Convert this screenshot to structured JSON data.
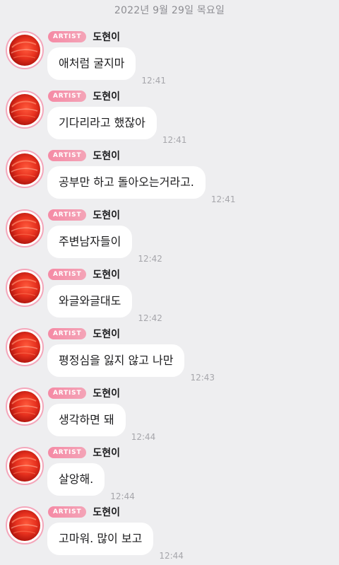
{
  "date_header": "2022년 9월 29일 목요일",
  "messages": [
    {
      "badge": "ARTIST",
      "sender": "도현이",
      "text": "애처럼 굴지마",
      "time": "12:41"
    },
    {
      "badge": "ARTIST",
      "sender": "도현이",
      "text": "기다리라고 했잖아",
      "time": "12:41"
    },
    {
      "badge": "ARTIST",
      "sender": "도현이",
      "text": "공부만 하고 돌아오는거라고.",
      "time": "12:41"
    },
    {
      "badge": "ARTIST",
      "sender": "도현이",
      "text": "주변남자들이",
      "time": "12:42"
    },
    {
      "badge": "ARTIST",
      "sender": "도현이",
      "text": "와글와글대도",
      "time": "12:42"
    },
    {
      "badge": "ARTIST",
      "sender": "도현이",
      "text": "평정심을 잃지 않고 나만",
      "time": "12:43"
    },
    {
      "badge": "ARTIST",
      "sender": "도현이",
      "text": "생각하면 돼",
      "time": "12:44"
    },
    {
      "badge": "ARTIST",
      "sender": "도현이",
      "text": "살앙해.",
      "time": "12:44"
    },
    {
      "badge": "ARTIST",
      "sender": "도현이",
      "text": "고마워. 많이 보고",
      "time": "12:44"
    }
  ],
  "colors": {
    "background": "#eeeef0",
    "bubble": "#ffffff",
    "badge": "#f58aa5",
    "avatar_ring": "#f4a6ba"
  },
  "icons": {
    "avatar": "red-meat-profile-image"
  }
}
